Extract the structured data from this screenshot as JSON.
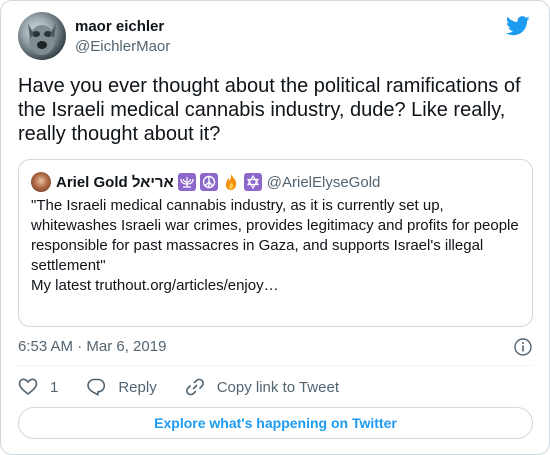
{
  "author": {
    "display_name": "maor eichler",
    "handle": "@EichlerMaor"
  },
  "tweet": {
    "text": "Have you ever thought about the political ramifications of the Israeli medical cannabis industry, dude? Like really, really thought about it?",
    "time": "6:53 AM · Mar 6, 2019"
  },
  "quoted_tweet": {
    "display_name": "Ariel Gold אריאל",
    "emojis": [
      "menorah-emoji",
      "peace-emoji",
      "fire-emoji",
      "star-of-david-emoji"
    ],
    "handle": "@ArielElyseGold",
    "text": "\"The Israeli medical cannabis industry, as it is currently set up, whitewashes Israeli war crimes, provides legitimacy and profits for people responsible for past massacres in Gaza, and supports Israel's illegal settlement\"",
    "link_text": "My latest truthout.org/articles/enjoy…"
  },
  "actions": {
    "like_count": "1",
    "reply_label": "Reply",
    "copy_link_label": "Copy link to Tweet"
  },
  "explore_label": "Explore what's happening on Twitter",
  "colors": {
    "brand": "#1d9bf0",
    "secondary_text": "#536471",
    "border": "#cfd9de"
  }
}
